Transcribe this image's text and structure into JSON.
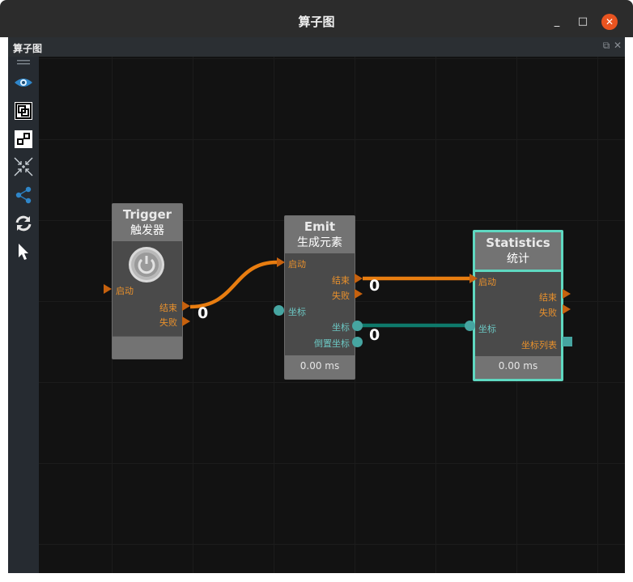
{
  "window": {
    "title": "算子图",
    "minimize": "_",
    "maximize": "□",
    "close": "✕"
  },
  "panel": {
    "title": "算子图",
    "float_icon": "⧉",
    "close_icon": "✕"
  },
  "toolbar": {
    "items": [
      {
        "name": "drag-handle-icon"
      },
      {
        "name": "eye-icon"
      },
      {
        "name": "fit-view-icon"
      },
      {
        "name": "auto-layout-icon"
      },
      {
        "name": "collapse-icon"
      },
      {
        "name": "share-graph-icon"
      },
      {
        "name": "refresh-icon"
      },
      {
        "name": "pointer-icon"
      }
    ]
  },
  "nodes": {
    "trigger": {
      "name": "Trigger",
      "subtitle": "触发器",
      "in_start": "启动",
      "out_end": "结束",
      "out_fail": "失败"
    },
    "emit": {
      "name": "Emit",
      "subtitle": "生成元素",
      "in_start": "启动",
      "out_end": "结束",
      "out_fail": "失败",
      "in_coord": "坐标",
      "out_coord": "坐标",
      "out_inv_coord": "倒置坐标",
      "timing": "0.00 ms"
    },
    "statistics": {
      "name": "Statistics",
      "subtitle": "统计",
      "in_start": "启动",
      "out_end": "结束",
      "out_fail": "失败",
      "in_coord": "坐标",
      "out_coord_list": "坐标列表",
      "timing": "0.00 ms"
    }
  },
  "connections": {
    "trigger_to_emit_count": "0",
    "emit_to_stats_count": "0",
    "emit_coord_to_stats_count": "0"
  },
  "colors": {
    "exec_wire": "#e87d10",
    "data_wire": "#0e7a6b",
    "selected_border": "#5fd8c1",
    "close_button": "#e95420"
  }
}
